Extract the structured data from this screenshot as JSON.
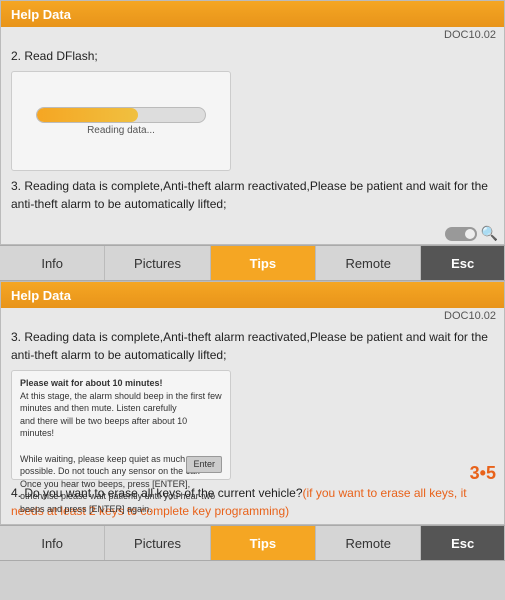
{
  "top_panel": {
    "header": "Help Data",
    "doc_ref": "DOC10.02",
    "step2_text": "2. Read DFlash;",
    "progress_label": "Reading data...",
    "step3_text": "3. Reading data is complete,Anti-theft alarm reactivated,Please be patient and wait for the anti-theft alarm to be automatically lifted;"
  },
  "bottom_panel": {
    "header": "Help Data",
    "doc_ref": "DOC10.02",
    "step3_text": "3. Reading data is complete,Anti-theft alarm reactivated,Please be patient and wait for the anti-theft alarm to be automatically lifted;",
    "image_content": {
      "line1": "Please wait for about 10 minutes!",
      "line2": "At this stage, the alarm should beep in the first few minutes and then mute. Listen carefully",
      "line3": "and there will be two beeps after about 10 minutes!",
      "line4": "While waiting, please keep quiet as much as possible. Do not touch any sensor on the car.",
      "line5": "Once you hear two beeps, press [ENTER], otherwise please wait patiently until you hear two",
      "line6": "beeps and press [ENTER] again.",
      "enter_label": "Enter"
    },
    "step4_text": "4. Do you want to erase all keys of the current vehicle?",
    "step4_highlight": "(if you want to erase all keys, it needs at least 2 keys to complete key programming)",
    "watermark": "3•5"
  },
  "tab_bars": {
    "tabs": [
      {
        "label": "Info",
        "active": false
      },
      {
        "label": "Pictures",
        "active": false
      },
      {
        "label": "Tips",
        "active": true
      },
      {
        "label": "Remote",
        "active": false
      }
    ],
    "esc_label": "Esc"
  }
}
